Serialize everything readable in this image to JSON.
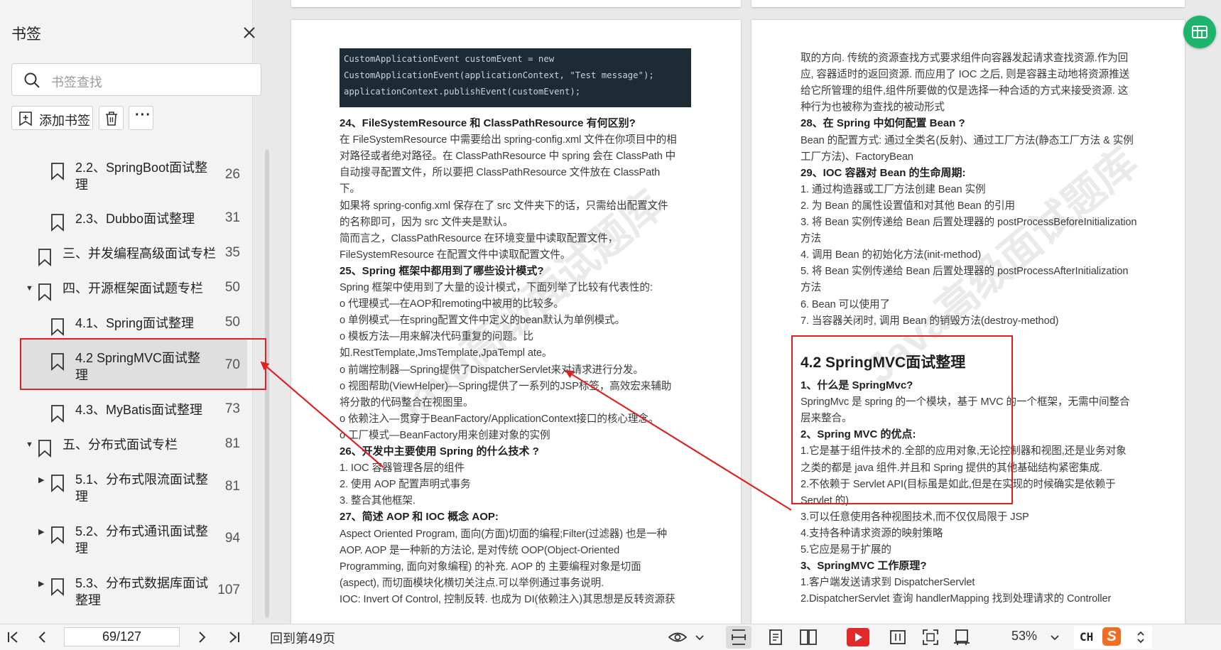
{
  "sidebar": {
    "title": "书签",
    "search_placeholder": "书签查找",
    "add_label": "添加书签",
    "more_label": "···",
    "items": [
      {
        "label": [
          "2.2、SpringBoot面试整",
          "理"
        ],
        "page": "26"
      },
      {
        "label": [
          "2.3、Dubbo面试整理"
        ],
        "page": "31"
      },
      {
        "label": [
          "三、并发编程高级面试专栏"
        ],
        "page": "35"
      },
      {
        "label": [
          "四、开源框架面试题专栏"
        ],
        "page": "50"
      },
      {
        "label": [
          "4.1、Spring面试整理"
        ],
        "page": "50"
      },
      {
        "label": [
          "4.2 SpringMVC面试整",
          "理"
        ],
        "page": "70"
      },
      {
        "label": [
          "4.3、MyBatis面试整理"
        ],
        "page": "73"
      },
      {
        "label": [
          "五、分布式面试专栏"
        ],
        "page": "81"
      },
      {
        "label": [
          "5.1、分布式限流面试整",
          "理"
        ],
        "page": "81"
      },
      {
        "label": [
          "5.2、分布式通讯面试整",
          "理"
        ],
        "page": "94"
      },
      {
        "label": [
          "5.3、分布式数据库面试",
          "整理"
        ],
        "page": "107"
      }
    ]
  },
  "left_page": {
    "code": [
      "CustomApplicationEvent customEvent = new",
      "CustomApplicationEvent(applicationContext, \"Test message\");",
      "applicationContext.publishEvent(customEvent);"
    ],
    "lines": [
      {
        "t": "24、FileSystemResource 和 ClassPathResource 有何区别?",
        "h": true
      },
      {
        "t": "在 FileSystemResource 中需要给出 spring-config.xml 文件在你项目中的相"
      },
      {
        "t": "对路径或者绝对路径。在 ClassPathResource 中 spring 会在 ClassPath 中"
      },
      {
        "t": "自动搜寻配置文件，所以要把 ClassPathResource 文件放在 ClassPath"
      },
      {
        "t": "下。"
      },
      {
        "t": "如果将 spring-config.xml 保存在了 src 文件夹下的话，只需给出配置文件"
      },
      {
        "t": "的名称即可，因为 src 文件夹是默认。"
      },
      {
        "t": "简而言之，ClassPathResource 在环境变量中读取配置文件，"
      },
      {
        "t": "FileSystemResource 在配置文件中读取配置文件。"
      },
      {
        "t": "25、Spring 框架中都用到了哪些设计模式?",
        "h": true
      },
      {
        "t": "Spring 框架中使用到了大量的设计模式，下面列举了比较有代表性的:"
      },
      {
        "t": "o 代理模式—在AOP和remoting中被用的比较多。"
      },
      {
        "t": "o 单例模式—在spring配置文件中定义的bean默认为单例模式。"
      },
      {
        "t": "o 模板方法—用来解决代码重复的问题。比"
      },
      {
        "t": "如.RestTemplate,JmsTemplate,JpaTempl ate。"
      },
      {
        "t": "o 前端控制器—Spring提供了DispatcherServlet来对请求进行分发。"
      },
      {
        "t": "o 视图帮助(ViewHelper)—Spring提供了一系列的JSP标签，高效宏来辅助"
      },
      {
        "t": "将分散的代码整合在视图里。"
      },
      {
        "t": "o 依赖注入—贯穿于BeanFactory/ApplicationContext接口的核心理念。"
      },
      {
        "t": "o 工厂模式—BeanFactory用来创建对象的实例"
      },
      {
        "t": "26、开发中主要使用 Spring 的什么技术 ?",
        "h": true
      },
      {
        "t": "1. IOC 容器管理各层的组件"
      },
      {
        "t": "2. 使用 AOP 配置声明式事务"
      },
      {
        "t": "3. 整合其他框架."
      },
      {
        "t": "27、简述 AOP 和 IOC 概念 AOP:",
        "h": true
      },
      {
        "t": "Aspect Oriented Program, 面向(方面)切面的编程;Filter(过滤器) 也是一种"
      },
      {
        "t": "AOP. AOP 是一种新的方法论, 是对传统 OOP(Object-Oriented"
      },
      {
        "t": "Programming, 面向对象编程) 的补充. AOP 的 主要编程对象是切面"
      },
      {
        "t": "(aspect), 而切面模块化横切关注点.可以举例通过事务说明."
      },
      {
        "t": "IOC: Invert Of Control, 控制反转. 也成为 DI(依赖注入)其思想是反转资源获"
      }
    ],
    "watermark": "Java高级面试题库"
  },
  "right_page": {
    "lines_top": [
      {
        "t": "取的方向. 传统的资源查找方式要求组件向容器发起请求查找资源.作为回"
      },
      {
        "t": "应, 容器适时的返回资源. 而应用了 IOC 之后, 则是容器主动地将资源推送"
      },
      {
        "t": "给它所管理的组件,组件所要做的仅是选择一种合适的方式来接受资源. 这"
      },
      {
        "t": "种行为也被称为查找的被动形式"
      },
      {
        "t": "28、在 Spring 中如何配置 Bean ?",
        "h": true
      },
      {
        "t": "Bean 的配置方式: 通过全类名(反射)、通过工厂方法(静态工厂方法 & 实例"
      },
      {
        "t": "工厂方法)、FactoryBean"
      },
      {
        "t": "29、IOC 容器对 Bean 的生命周期:",
        "h": true
      },
      {
        "t": "1. 通过构造器或工厂方法创建 Bean 实例"
      },
      {
        "t": "2. 为 Bean 的属性设置值和对其他 Bean 的引用"
      },
      {
        "t": "3. 将 Bean 实例传递给 Bean 后置处理器的 postProcessBeforeInitialization"
      },
      {
        "t": "方法"
      },
      {
        "t": "4. 调用 Bean 的初始化方法(init-method)"
      },
      {
        "t": "5. 将 Bean 实例传递给 Bean 后置处理器的 postProcessAfterInitialization"
      },
      {
        "t": "方法"
      },
      {
        "t": "6. Bean 可以使用了"
      },
      {
        "t": "7. 当容器关闭时, 调用 Bean 的销毁方法(destroy-method)"
      }
    ],
    "section_title": "4.2 SpringMVC面试整理",
    "lines_bottom": [
      {
        "t": "1、什么是 SpringMvc?",
        "h": true
      },
      {
        "t": "SpringMvc 是 spring 的一个模块，基于 MVC 的一个框架，无需中间整合"
      },
      {
        "t": "层来整合。"
      },
      {
        "t": "2、Spring MVC 的优点:",
        "h": true
      },
      {
        "t": "1.它是基于组件技术的.全部的应用对象,无论控制器和视图,还是业务对象"
      },
      {
        "t": "之类的都是 java 组件.并且和 Spring 提供的其他基础结构紧密集成."
      },
      {
        "t": "2.不依赖于 Servlet API(目标虽是如此,但是在实现的时候确实是依赖于"
      },
      {
        "t": "Servlet 的)"
      },
      {
        "t": "3.可以任意使用各种视图技术,而不仅仅局限于 JSP"
      },
      {
        "t": "4.支持各种请求资源的映射策略"
      },
      {
        "t": "5.它应是易于扩展的"
      },
      {
        "t": "3、SpringMVC 工作原理?",
        "h": true
      },
      {
        "t": "1.客户端发送请求到 DispatcherServlet"
      },
      {
        "t": "2.DispatcherServlet 查询 handlerMapping 找到处理请求的 Controller"
      }
    ],
    "watermark": "Java高级面试题库"
  },
  "bottombar": {
    "page_input": "69/127",
    "goto": "回到第49页",
    "zoom": "53%",
    "ime": "CH"
  },
  "colors": {
    "highlight_red": "#e02020",
    "fab_green": "#1db56c",
    "play_red": "#e02a2a",
    "code_bg": "#1d2b34"
  }
}
